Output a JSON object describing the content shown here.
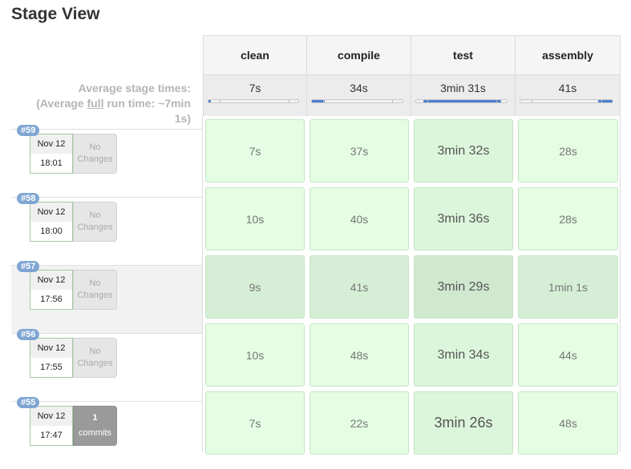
{
  "title": "Stage View",
  "avg_label": {
    "line1": "Average stage times:",
    "line2_prefix": "(Average ",
    "line2_link": "full",
    "line2_suffix": " run time: ~7min",
    "line3": "1s)"
  },
  "stages": [
    {
      "name": "clean",
      "avg": "7s",
      "avg_fraction": 0.03
    },
    {
      "name": "compile",
      "avg": "34s",
      "avg_fraction": 0.14
    },
    {
      "name": "test",
      "avg": "3min 31s",
      "avg_fraction": 0.85
    },
    {
      "name": "assembly",
      "avg": "41s",
      "avg_fraction": 0.16
    }
  ],
  "builds": [
    {
      "id": "#59",
      "date": "Nov 12",
      "time": "18:01",
      "changes": [
        "No",
        "Changes"
      ],
      "commits": false,
      "durations": [
        "7s",
        "37s",
        "3min 32s",
        "28s"
      ]
    },
    {
      "id": "#58",
      "date": "Nov 12",
      "time": "18:00",
      "changes": [
        "No",
        "Changes"
      ],
      "commits": false,
      "durations": [
        "10s",
        "40s",
        "3min 36s",
        "28s"
      ]
    },
    {
      "id": "#57",
      "date": "Nov 12",
      "time": "17:56",
      "changes": [
        "No",
        "Changes"
      ],
      "commits": false,
      "durations": [
        "9s",
        "41s",
        "3min 29s",
        "1min 1s"
      ]
    },
    {
      "id": "#56",
      "date": "Nov 12",
      "time": "17:55",
      "changes": [
        "No",
        "Changes"
      ],
      "commits": false,
      "durations": [
        "10s",
        "48s",
        "3min 34s",
        "44s"
      ]
    },
    {
      "id": "#55",
      "date": "Nov 12",
      "time": "17:47",
      "changes": [
        "1",
        "commits"
      ],
      "commits": true,
      "durations": [
        "7s",
        "22s",
        "3min 26s",
        "48s"
      ]
    }
  ],
  "colors": {
    "success_cell": "#e4fde3",
    "progress_fill": "#4a7fd0",
    "build_badge": "#7fa6d3"
  }
}
